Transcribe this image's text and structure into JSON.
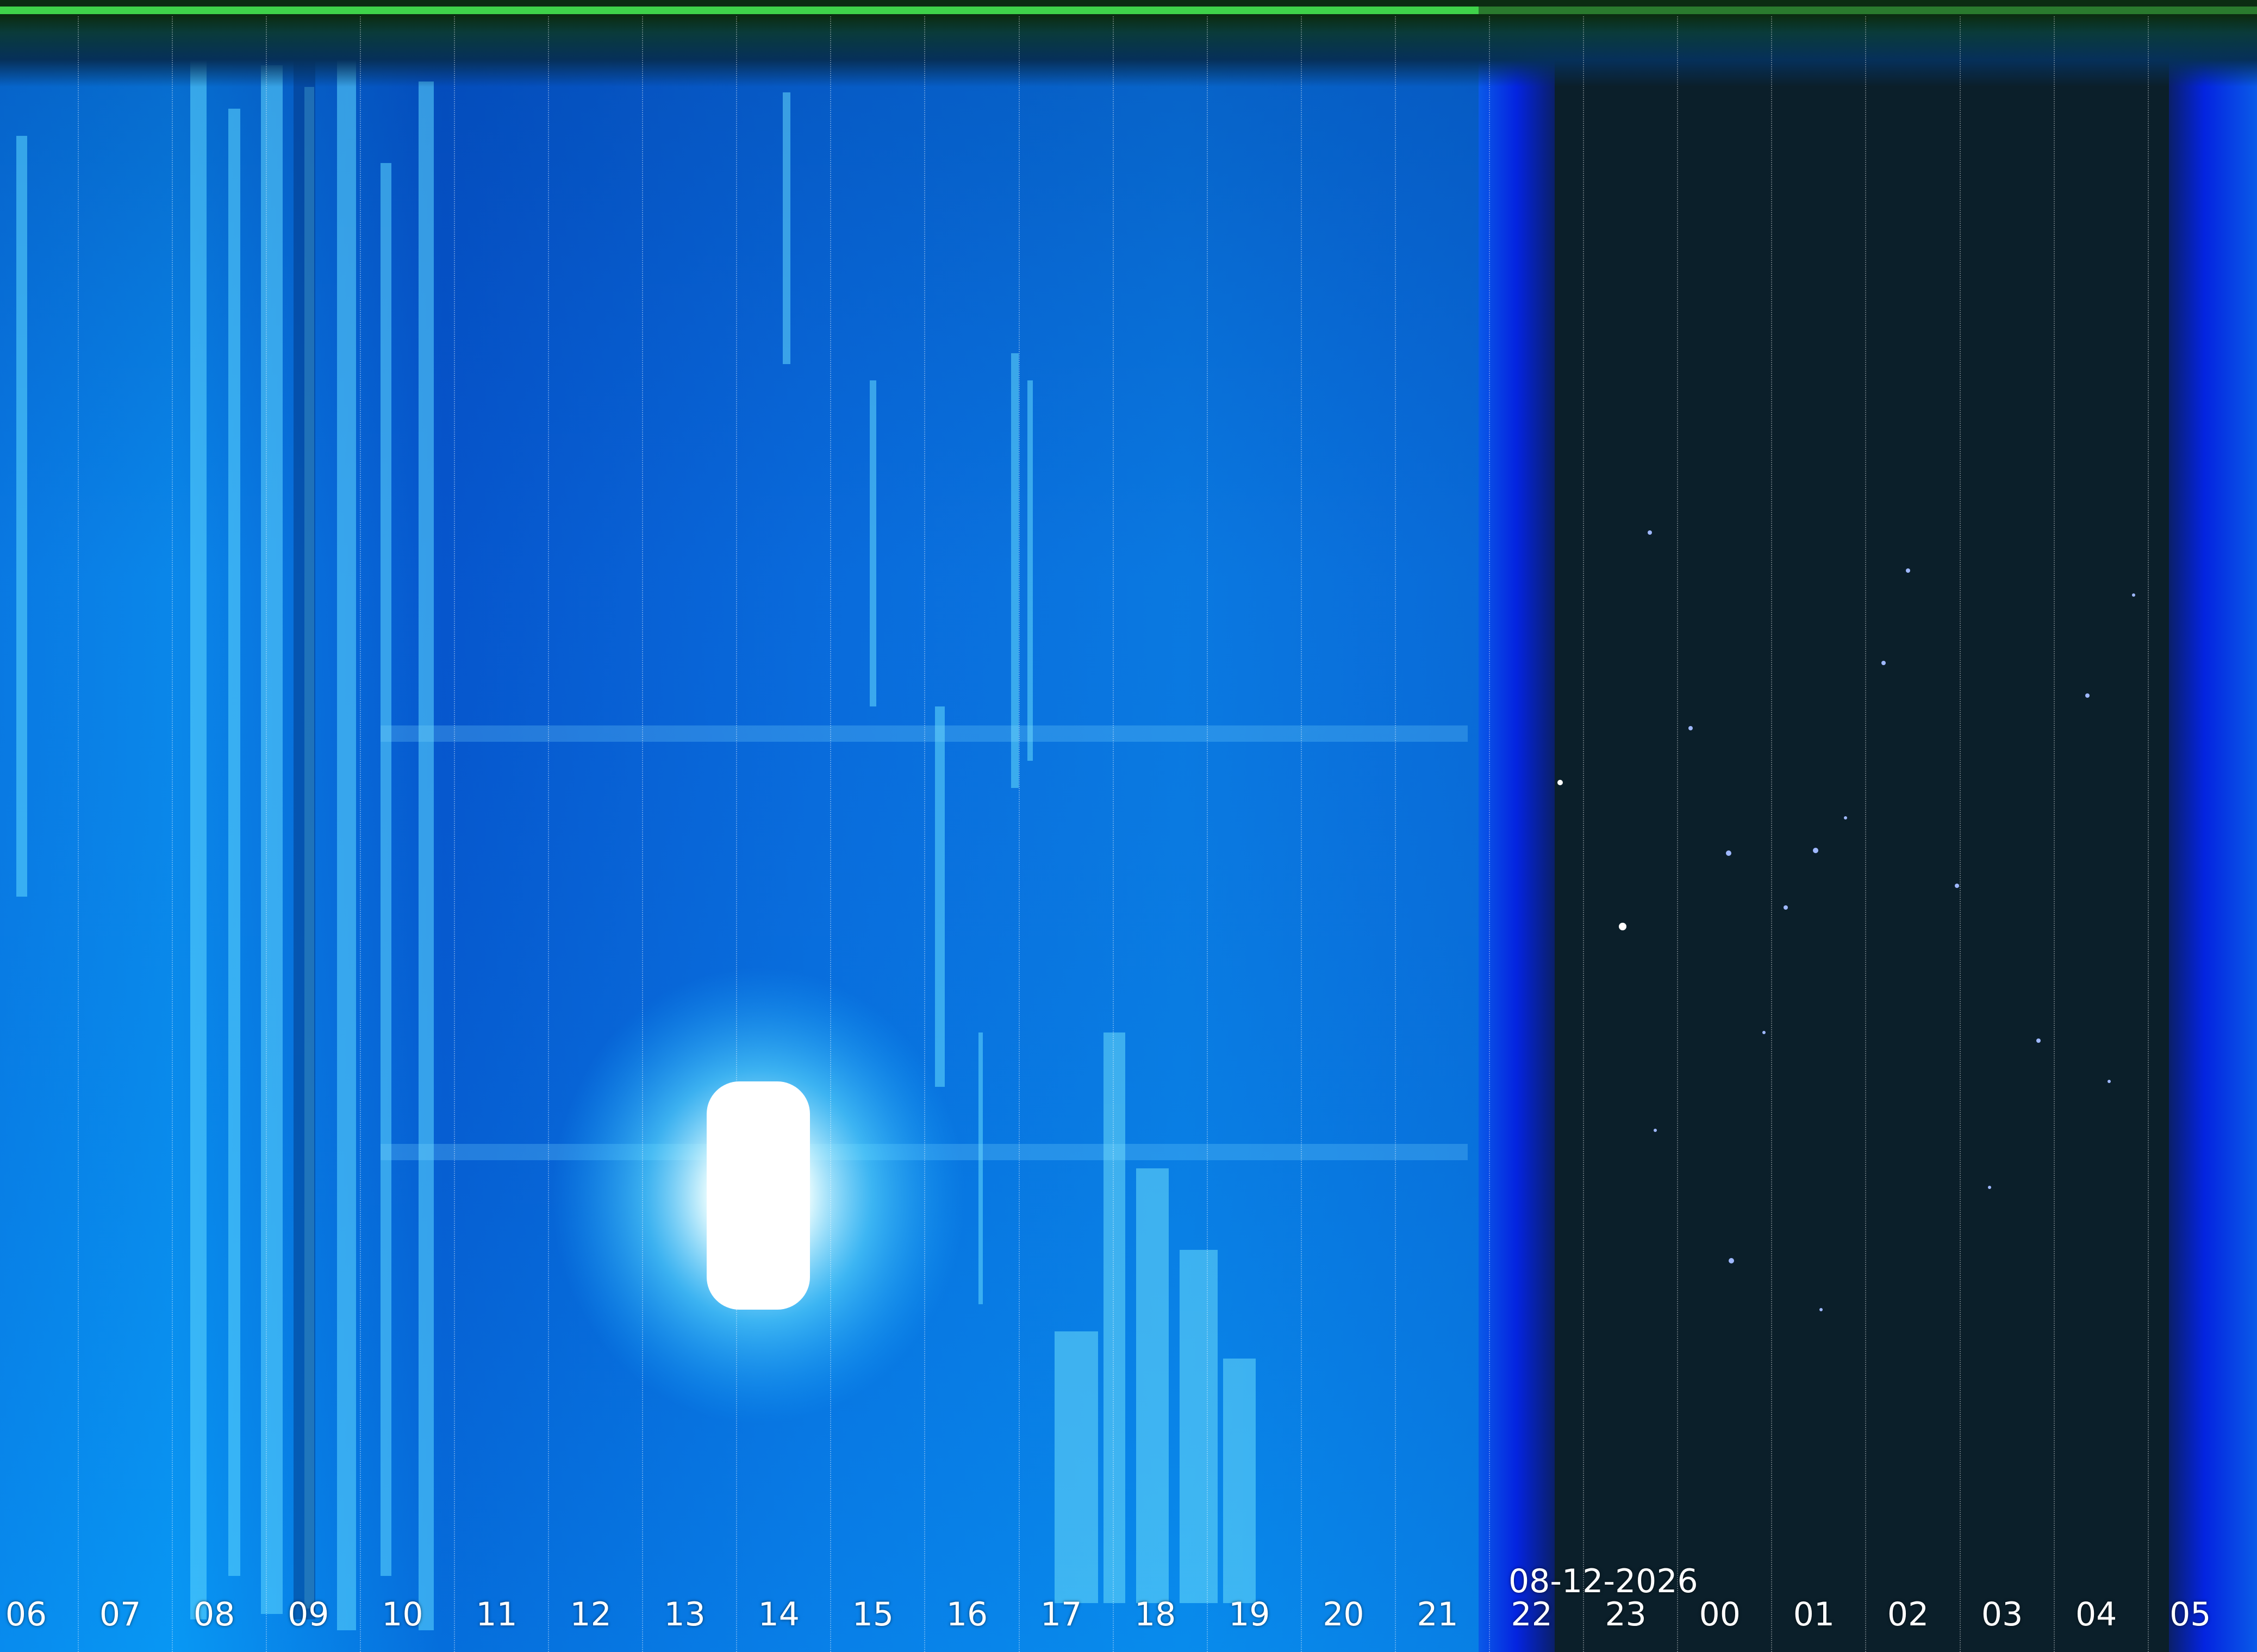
{
  "date": "08-12-2026",
  "hours": [
    "06",
    "07",
    "08",
    "09",
    "10",
    "11",
    "12",
    "13",
    "14",
    "15",
    "16",
    "17",
    "18",
    "19",
    "20",
    "21",
    "22",
    "23",
    "00",
    "01",
    "02",
    "03",
    "04",
    "05"
  ],
  "colors": {
    "day_sky": "#0a6fe0",
    "deep_blue": "#0626d8",
    "night_sky": "#0b1f2a",
    "status_green": "#3fd34a",
    "status_dim": "#2a7a2e",
    "label": "#ffffff"
  }
}
